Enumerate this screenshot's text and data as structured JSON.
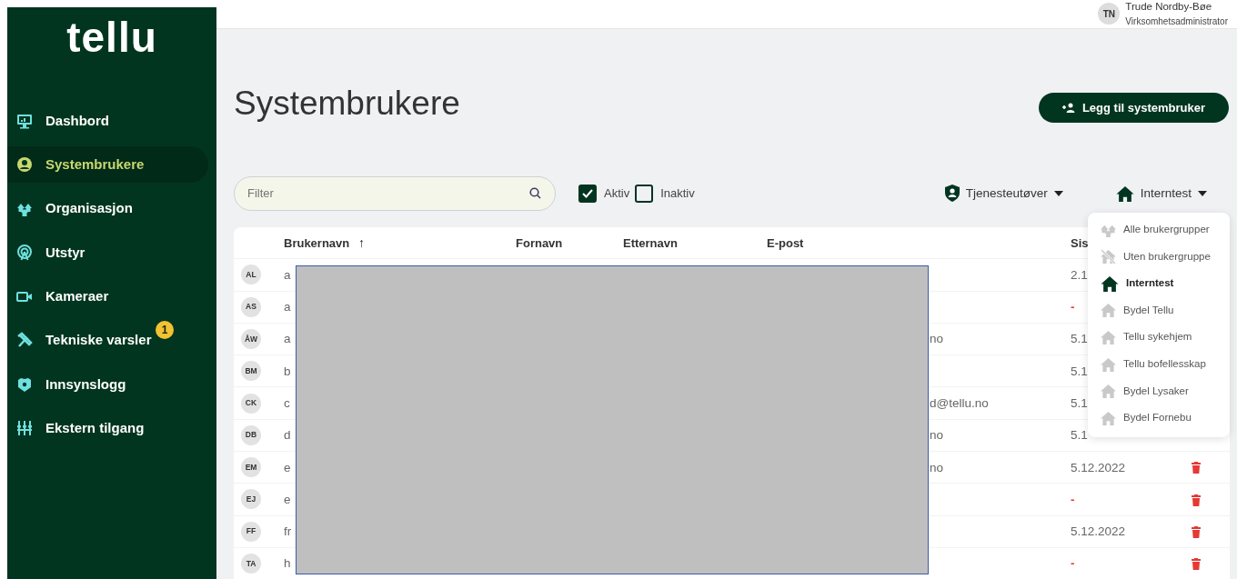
{
  "sidebar": {
    "logo": "tellu",
    "items": [
      {
        "label": "Dashbord",
        "selected": false
      },
      {
        "label": "Systembrukere",
        "selected": true
      },
      {
        "label": "Organisasjon",
        "selected": false
      },
      {
        "label": "Utstyr",
        "selected": false
      },
      {
        "label": "Kameraer",
        "selected": false
      },
      {
        "label": "Tekniske varsler",
        "selected": false,
        "badge": "1"
      },
      {
        "label": "Innsynslogg",
        "selected": false
      },
      {
        "label": "Ekstern tilgang",
        "selected": false
      }
    ]
  },
  "user": {
    "initials": "TN",
    "name": "Trude Nordby-Bøe",
    "role": "Virksomhetsadministrator"
  },
  "page": {
    "title": "Systembrukere",
    "add_button": "Legg til systembruker"
  },
  "filter": {
    "placeholder": "Filter"
  },
  "status_filters": [
    {
      "label": "Aktiv",
      "checked": true
    },
    {
      "label": "Inaktiv",
      "checked": false
    }
  ],
  "role_dropdown": {
    "label": "Tjenesteutøver"
  },
  "group_dropdown": {
    "label": "Interntest",
    "expanded": true,
    "options": [
      {
        "label": "Alle brukergrupper",
        "kind": "all",
        "selected": false
      },
      {
        "label": "Uten brukergruppe",
        "kind": "none",
        "selected": false
      },
      {
        "label": "Interntest",
        "kind": "group",
        "selected": true
      },
      {
        "label": "Bydel Tellu",
        "kind": "group",
        "selected": false
      },
      {
        "label": "Tellu sykehjem",
        "kind": "group",
        "selected": false
      },
      {
        "label": "Tellu bofellesskap",
        "kind": "group",
        "selected": false
      },
      {
        "label": "Bydel Lysaker",
        "kind": "group",
        "selected": false
      },
      {
        "label": "Bydel Fornebu",
        "kind": "group",
        "selected": false
      }
    ]
  },
  "table": {
    "columns": [
      "Brukernavn",
      "Fornavn",
      "Etternavn",
      "E-post",
      "Sis"
    ],
    "sort_icon": "↑",
    "rows": [
      {
        "initials": "AL",
        "username": "a",
        "email": "",
        "last_login": "2.1",
        "never": false,
        "trash": false
      },
      {
        "initials": "AS",
        "username": "a",
        "email": "",
        "last_login": "-",
        "never": true,
        "trash": false
      },
      {
        "initials": "ÅW",
        "username": "a",
        "email": "no",
        "last_login": "5.1",
        "never": false,
        "trash": false
      },
      {
        "initials": "BM",
        "username": "b",
        "email": "",
        "last_login": "5.1",
        "never": false,
        "trash": false
      },
      {
        "initials": "CK",
        "username": "c",
        "email": "d@tellu.no",
        "last_login": "5.1",
        "never": false,
        "trash": false
      },
      {
        "initials": "DB",
        "username": "d",
        "email": "no",
        "last_login": "5.1",
        "never": false,
        "trash": false
      },
      {
        "initials": "EM",
        "username": "e",
        "email": "no",
        "last_login": "5.12.2022",
        "never": false,
        "trash": true
      },
      {
        "initials": "EJ",
        "username": "e",
        "email": "",
        "last_login": "-",
        "never": true,
        "trash": true
      },
      {
        "initials": "FF",
        "username": "fr",
        "email": "",
        "last_login": "5.12.2022",
        "never": false,
        "trash": true
      },
      {
        "initials": "TA",
        "username": "h",
        "email": "",
        "last_login": "-",
        "never": true,
        "trash": true
      }
    ]
  }
}
